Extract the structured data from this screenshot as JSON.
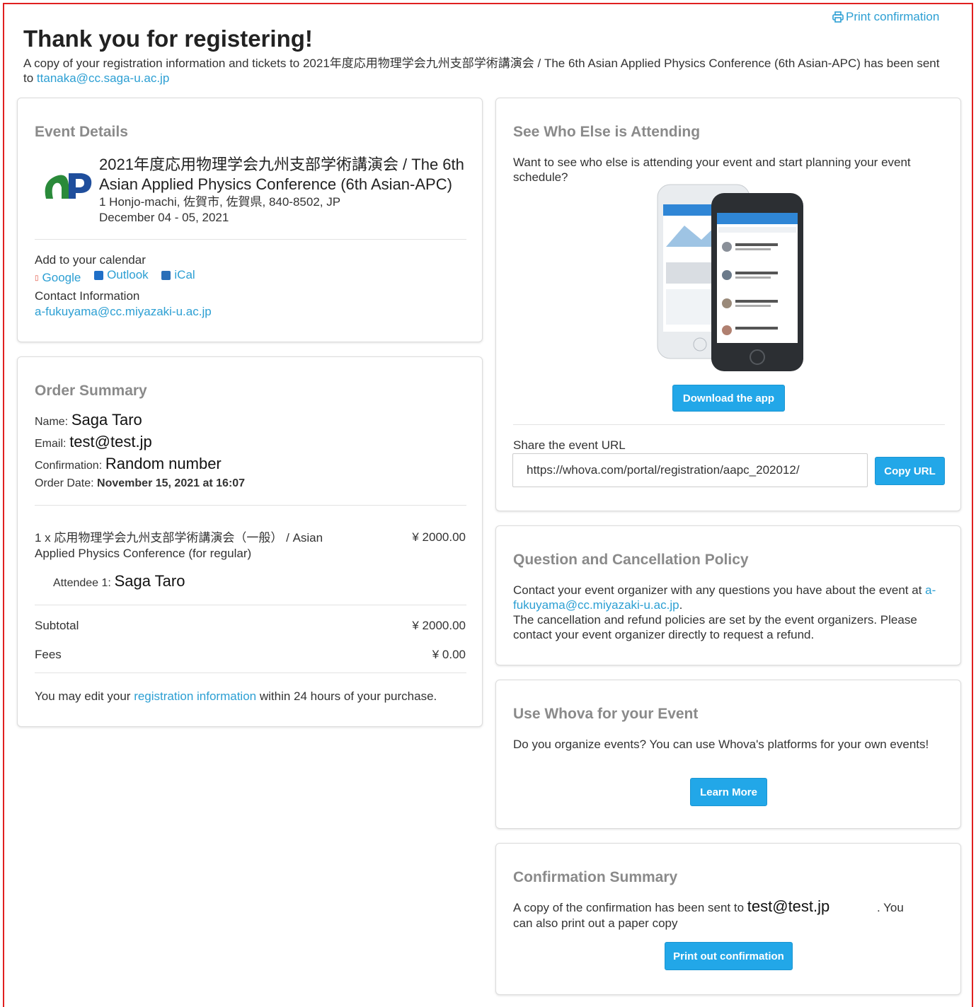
{
  "header": {
    "print_link": "Print confirmation",
    "title": "Thank you for registering!",
    "intro_text": "A copy of your registration information and tickets to 2021年度応用物理学会九州支部学術講演会 / The 6th Asian Applied Physics Conference (6th Asian-APC) has been sent to",
    "intro_email": "ttanaka@cc.saga-u.ac.jp"
  },
  "event_details": {
    "heading": "Event Details",
    "logo_text": "AP",
    "name_line1": "2021年度応用物理学会九州支部学術講演会 / The 6th",
    "name_line2": "Asian Applied Physics Conference (6th Asian-APC)",
    "address": "1 Honjo-machi, 佐賀市, 佐賀県, 840-8502, JP",
    "dates": "December 04 - 05, 2021",
    "calendar_label": "Add to your calendar",
    "calendar_links": [
      "Google",
      "Outlook",
      "iCal"
    ],
    "contact_label": "Contact Information",
    "contact_email": "a-fukuyama@cc.miyazaki-u.ac.jp"
  },
  "order_summary": {
    "heading": "Order Summary",
    "name_label": "Name:",
    "name_value": "Saga Taro",
    "email_label": "Email:",
    "email_value": "test@test.jp",
    "confirmation_label": "Confirmation:",
    "confirmation_value": "Random number",
    "order_date_label": "Order Date:",
    "order_date_value": "November 15, 2021 at 16:07",
    "item_line1": "1 x 応用物理学会九州支部学術講演会（一般） / Asian",
    "item_line2": "Applied Physics Conference (for regular)",
    "item_price": "¥ 2000.00",
    "attendee_label": "Attendee 1:",
    "attendee_value": "Saga Taro",
    "subtotal_label": "Subtotal",
    "subtotal_value": "¥ 2000.00",
    "fees_label": "Fees",
    "fees_value": "¥ 0.00",
    "edit_prefix": "You may edit your",
    "edit_link": "registration information",
    "edit_suffix": "within 24 hours of your purchase."
  },
  "attending": {
    "heading": "See Who Else is Attending",
    "text": "Want to see who else is attending your event and start planning your event schedule?",
    "download_button": "Download the app",
    "share_label": "Share the event URL",
    "share_url": "https://whova.com/portal/registration/aapc_202012/",
    "copy_button": "Copy URL"
  },
  "policy": {
    "heading": "Question and Cancellation Policy",
    "text1_prefix": "Contact your event organizer with any questions you have about the event at",
    "contact_email": "a-fukuyama@cc.miyazaki-u.ac.jp",
    "text2": "The cancellation and refund policies are set by the event organizers. Please contact your event organizer directly to request a refund."
  },
  "use_whova": {
    "heading": "Use Whova for your Event",
    "text": "Do you organize events? You can use Whova's platforms for your own events!",
    "button": "Learn More"
  },
  "confirmation_summary": {
    "heading": "Confirmation Summary",
    "text_prefix": "A copy of the confirmation has been sent to",
    "email": "test@test.jp",
    "text_suffix": ". You",
    "text_line2": "can also print out a paper copy",
    "button": "Print out confirmation"
  },
  "colors": {
    "accent": "#22a7e8",
    "link": "#2c9fd3",
    "heading_gray": "#8a8a8a",
    "frame_red": "#e02020"
  }
}
